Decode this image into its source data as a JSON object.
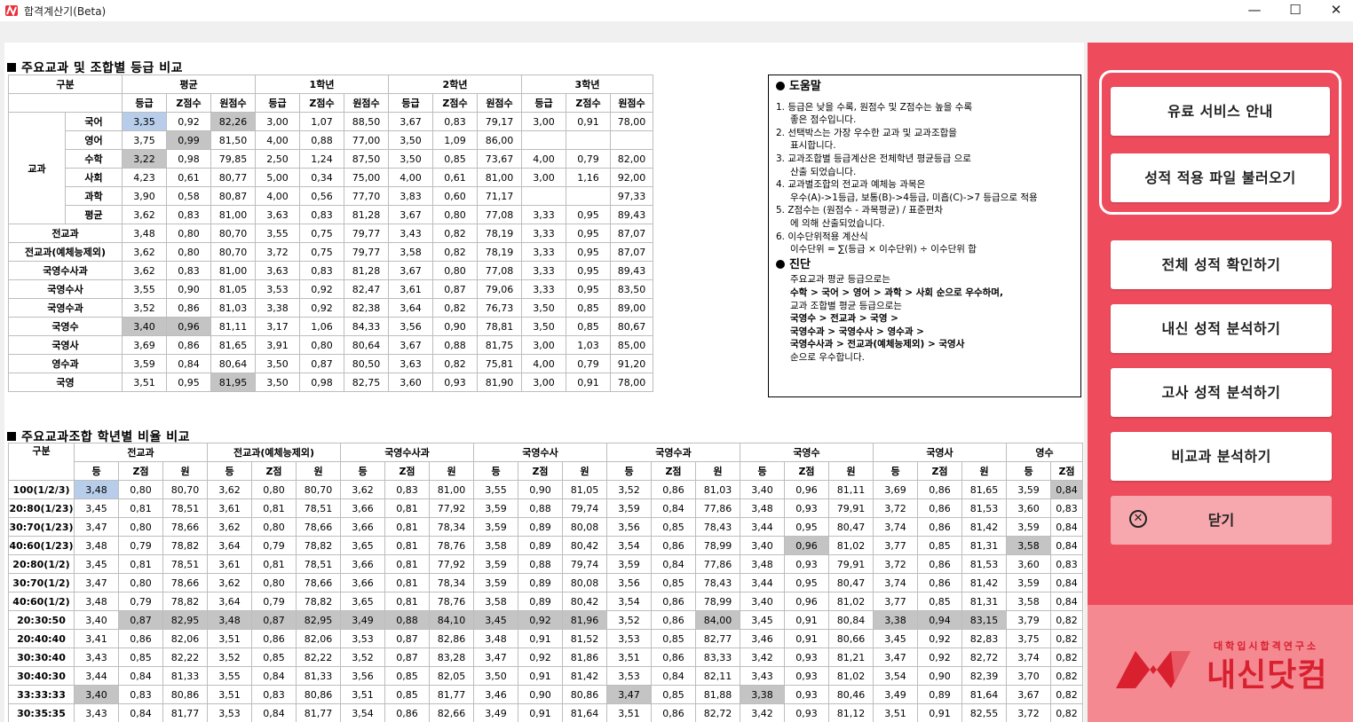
{
  "window": {
    "title": "합격계산기(Beta)",
    "minimize": "—",
    "maximize": "☐",
    "close": "✕"
  },
  "sections": {
    "grade_compare": "주요교과 및 조합별 등급 비교",
    "ratio_compare": "주요교과조합 학년별 비율 비교"
  },
  "table1": {
    "header": {
      "gubun": "구분",
      "avg": "평균",
      "y1": "1학년",
      "y2": "2학년",
      "y3": "3학년",
      "sub": [
        "등급",
        "Z점수",
        "원점수"
      ],
      "group": "교과"
    },
    "rows": [
      {
        "label": "국어",
        "cells": [
          "3,35",
          "0,92",
          "82,26",
          "3,00",
          "1,07",
          "88,50",
          "3,67",
          "0,83",
          "79,17",
          "3,00",
          "0,91",
          "78,00"
        ]
      },
      {
        "label": "영어",
        "cells": [
          "3,75",
          "0,99",
          "81,50",
          "4,00",
          "0,88",
          "77,00",
          "3,50",
          "1,09",
          "86,00",
          "",
          "",
          ""
        ]
      },
      {
        "label": "수학",
        "cells": [
          "3,22",
          "0,98",
          "79,85",
          "2,50",
          "1,24",
          "87,50",
          "3,50",
          "0,85",
          "73,67",
          "4,00",
          "0,79",
          "82,00"
        ]
      },
      {
        "label": "사회",
        "cells": [
          "4,23",
          "0,61",
          "80,77",
          "5,00",
          "0,34",
          "75,00",
          "4,00",
          "0,61",
          "81,00",
          "3,00",
          "1,16",
          "92,00"
        ]
      },
      {
        "label": "과학",
        "cells": [
          "3,90",
          "0,58",
          "80,87",
          "4,00",
          "0,56",
          "77,70",
          "3,83",
          "0,60",
          "71,17",
          "",
          "",
          "97,33"
        ]
      },
      {
        "label": "평균",
        "cells": [
          "3,62",
          "0,83",
          "81,00",
          "3,63",
          "0,83",
          "81,28",
          "3,67",
          "0,80",
          "77,08",
          "3,33",
          "0,95",
          "89,43"
        ]
      },
      {
        "label": "전교과",
        "cells": [
          "3,48",
          "0,80",
          "80,70",
          "3,55",
          "0,75",
          "79,77",
          "3,43",
          "0,82",
          "78,19",
          "3,33",
          "0,95",
          "87,07"
        ]
      },
      {
        "label": "전교과(예체능제외)",
        "cells": [
          "3,62",
          "0,80",
          "80,70",
          "3,72",
          "0,75",
          "79,77",
          "3,58",
          "0,82",
          "78,19",
          "3,33",
          "0,95",
          "87,07"
        ]
      },
      {
        "label": "국영수사과",
        "cells": [
          "3,62",
          "0,83",
          "81,00",
          "3,63",
          "0,83",
          "81,28",
          "3,67",
          "0,80",
          "77,08",
          "3,33",
          "0,95",
          "89,43"
        ]
      },
      {
        "label": "국영수사",
        "cells": [
          "3,55",
          "0,90",
          "81,05",
          "3,53",
          "0,92",
          "82,47",
          "3,61",
          "0,87",
          "79,06",
          "3,33",
          "0,95",
          "83,50"
        ]
      },
      {
        "label": "국영수과",
        "cells": [
          "3,52",
          "0,86",
          "81,03",
          "3,38",
          "0,92",
          "82,38",
          "3,64",
          "0,82",
          "76,73",
          "3,50",
          "0,85",
          "89,00"
        ]
      },
      {
        "label": "국영수",
        "cells": [
          "3,40",
          "0,96",
          "81,11",
          "3,17",
          "1,06",
          "84,33",
          "3,56",
          "0,90",
          "78,81",
          "3,50",
          "0,85",
          "80,67"
        ]
      },
      {
        "label": "국영사",
        "cells": [
          "3,69",
          "0,86",
          "81,65",
          "3,91",
          "0,80",
          "80,64",
          "3,67",
          "0,88",
          "81,75",
          "3,00",
          "1,03",
          "85,00"
        ]
      },
      {
        "label": "영수과",
        "cells": [
          "3,59",
          "0,84",
          "80,64",
          "3,50",
          "0,87",
          "80,50",
          "3,63",
          "0,82",
          "75,81",
          "4,00",
          "0,79",
          "91,20"
        ]
      },
      {
        "label": "국영",
        "cells": [
          "3,51",
          "0,95",
          "81,95",
          "3,50",
          "0,98",
          "82,75",
          "3,60",
          "0,93",
          "81,90",
          "3,00",
          "0,91",
          "78,00"
        ]
      }
    ]
  },
  "help": {
    "title": "도움말",
    "lines": [
      "1. 등급은 낮을 수록, 원점수 및 Z점수는 높을 수록",
      "    좋은 점수입니다.",
      "2. 선택박스는 가장 우수한 교과 및 교과조합을",
      "    표시합니다.",
      "3. 교과조합별 등급계산은 전체학년 평균등급 으로",
      "    산출 되었습니다.",
      "4. 교과별조합의 전교과 예체능 과목은",
      "    우수(A)->1등급, 보통(B)->4등급, 미흡(C)->7 등급으로 적용",
      "5. Z점수는 (원점수 - 과목평균) / 표준편차",
      "    에 의해 산출되었습니다.",
      "6. 이수단위적용 계산식",
      "    이수단위 = ∑(등급 × 이수단위) ÷ 이수단위 합"
    ],
    "diag_title": "진단",
    "diag_lines": [
      "주요교과 평균 등급으로는",
      "수학 > 국어 > 영어 > 과학 > 사회 순으로 우수하며,",
      "교과 조합별 평균 등급으로는",
      "국영수 > 전교과 > 국영 >",
      "국영수과 > 국영수사 > 영수과 >",
      "국영수사과 > 전교과(예체능제외) > 국영사",
      "순으로 우수합니다."
    ]
  },
  "table2": {
    "gubun": "구분",
    "groups": [
      "전교과",
      "전교과(예체능제외)",
      "국영수사과",
      "국영수사",
      "국영수과",
      "국영수",
      "국영사",
      "영수"
    ],
    "sub": [
      "등",
      "Z점",
      "원"
    ],
    "rows": [
      {
        "label": "100(1/2/3)",
        "cells": [
          "3,48",
          "0,80",
          "80,70",
          "3,62",
          "0,80",
          "80,70",
          "3,62",
          "0,83",
          "81,00",
          "3,55",
          "0,90",
          "81,05",
          "3,52",
          "0,86",
          "81,03",
          "3,40",
          "0,96",
          "81,11",
          "3,69",
          "0,86",
          "81,65",
          "3,59",
          "0,84"
        ]
      },
      {
        "label": "20:80(1/23)",
        "cells": [
          "3,45",
          "0,81",
          "78,51",
          "3,61",
          "0,81",
          "78,51",
          "3,66",
          "0,81",
          "77,92",
          "3,59",
          "0,88",
          "79,74",
          "3,59",
          "0,84",
          "77,86",
          "3,48",
          "0,93",
          "79,91",
          "3,72",
          "0,86",
          "81,53",
          "3,60",
          "0,83"
        ]
      },
      {
        "label": "30:70(1/23)",
        "cells": [
          "3,47",
          "0,80",
          "78,66",
          "3,62",
          "0,80",
          "78,66",
          "3,66",
          "0,81",
          "78,34",
          "3,59",
          "0,89",
          "80,08",
          "3,56",
          "0,85",
          "78,43",
          "3,44",
          "0,95",
          "80,47",
          "3,74",
          "0,86",
          "81,42",
          "3,59",
          "0,84"
        ]
      },
      {
        "label": "40:60(1/23)",
        "cells": [
          "3,48",
          "0,79",
          "78,82",
          "3,64",
          "0,79",
          "78,82",
          "3,65",
          "0,81",
          "78,76",
          "3,58",
          "0,89",
          "80,42",
          "3,54",
          "0,86",
          "78,99",
          "3,40",
          "0,96",
          "81,02",
          "3,77",
          "0,85",
          "81,31",
          "3,58",
          "0,84"
        ]
      },
      {
        "label": "20:80(1/2)",
        "cells": [
          "3,45",
          "0,81",
          "78,51",
          "3,61",
          "0,81",
          "78,51",
          "3,66",
          "0,81",
          "77,92",
          "3,59",
          "0,88",
          "79,74",
          "3,59",
          "0,84",
          "77,86",
          "3,48",
          "0,93",
          "79,91",
          "3,72",
          "0,86",
          "81,53",
          "3,60",
          "0,83"
        ]
      },
      {
        "label": "30:70(1/2)",
        "cells": [
          "3,47",
          "0,80",
          "78,66",
          "3,62",
          "0,80",
          "78,66",
          "3,66",
          "0,81",
          "78,34",
          "3,59",
          "0,89",
          "80,08",
          "3,56",
          "0,85",
          "78,43",
          "3,44",
          "0,95",
          "80,47",
          "3,74",
          "0,86",
          "81,42",
          "3,59",
          "0,84"
        ]
      },
      {
        "label": "40:60(1/2)",
        "cells": [
          "3,48",
          "0,79",
          "78,82",
          "3,64",
          "0,79",
          "78,82",
          "3,65",
          "0,81",
          "78,76",
          "3,58",
          "0,89",
          "80,42",
          "3,54",
          "0,86",
          "78,99",
          "3,40",
          "0,96",
          "81,02",
          "3,77",
          "0,85",
          "81,31",
          "3,58",
          "0,84"
        ]
      },
      {
        "label": "20:30:50",
        "cells": [
          "3,40",
          "0,87",
          "82,95",
          "3,48",
          "0,87",
          "82,95",
          "3,49",
          "0,88",
          "84,10",
          "3,45",
          "0,92",
          "81,96",
          "3,52",
          "0,86",
          "84,00",
          "3,45",
          "0,91",
          "80,84",
          "3,38",
          "0,94",
          "83,15",
          "3,79",
          "0,82"
        ]
      },
      {
        "label": "20:40:40",
        "cells": [
          "3,41",
          "0,86",
          "82,06",
          "3,51",
          "0,86",
          "82,06",
          "3,53",
          "0,87",
          "82,86",
          "3,48",
          "0,91",
          "81,52",
          "3,53",
          "0,85",
          "82,77",
          "3,46",
          "0,91",
          "80,66",
          "3,45",
          "0,92",
          "82,83",
          "3,75",
          "0,82"
        ]
      },
      {
        "label": "30:30:40",
        "cells": [
          "3,43",
          "0,85",
          "82,22",
          "3,52",
          "0,85",
          "82,22",
          "3,52",
          "0,87",
          "83,28",
          "3,47",
          "0,92",
          "81,86",
          "3,51",
          "0,86",
          "83,33",
          "3,42",
          "0,93",
          "81,21",
          "3,47",
          "0,92",
          "82,72",
          "3,74",
          "0,82"
        ]
      },
      {
        "label": "30:40:30",
        "cells": [
          "3,44",
          "0,84",
          "81,33",
          "3,55",
          "0,84",
          "81,33",
          "3,56",
          "0,85",
          "82,05",
          "3,50",
          "0,91",
          "81,42",
          "3,53",
          "0,84",
          "82,11",
          "3,43",
          "0,93",
          "81,02",
          "3,54",
          "0,90",
          "82,39",
          "3,70",
          "0,82"
        ]
      },
      {
        "label": "33:33:33",
        "cells": [
          "3,40",
          "0,83",
          "80,86",
          "3,51",
          "0,83",
          "80,86",
          "3,51",
          "0,85",
          "81,77",
          "3,46",
          "0,90",
          "80,86",
          "3,47",
          "0,85",
          "81,88",
          "3,38",
          "0,93",
          "80,46",
          "3,49",
          "0,89",
          "81,64",
          "3,67",
          "0,82"
        ]
      },
      {
        "label": "30:35:35",
        "cells": [
          "3,43",
          "0,84",
          "81,77",
          "3,53",
          "0,84",
          "81,77",
          "3,54",
          "0,86",
          "82,66",
          "3,49",
          "0,91",
          "81,64",
          "3,51",
          "0,86",
          "82,72",
          "3,42",
          "0,93",
          "81,12",
          "3,51",
          "0,91",
          "82,55",
          "3,72",
          "0,82"
        ]
      }
    ]
  },
  "sidebar": {
    "buttons": [
      "유료 서비스 안내",
      "성적 적용 파일 불러오기",
      "전체 성적 확인하기",
      "내신 성적 분석하기",
      "고사 성적 분석하기",
      "비교과 분석하기"
    ],
    "close": "닫기",
    "logo_small": "대학입시합격연구소",
    "logo_big": "내신닷컴"
  },
  "colors": {
    "sidebar": "#ee4c5c",
    "sidebar_bottom": "#f48992",
    "highlight_blue": "#b7cdea",
    "highlight_gray": "#c4c4c4",
    "brand_red": "#d8202f"
  }
}
